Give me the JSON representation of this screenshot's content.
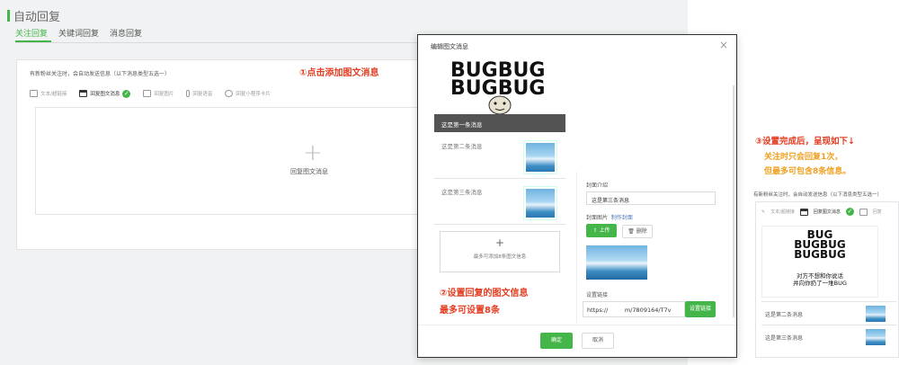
{
  "page": {
    "title": "自动回复",
    "tabs": [
      {
        "label": "关注回复",
        "active": true
      },
      {
        "label": "关键词回复"
      },
      {
        "label": "消息回复"
      }
    ],
    "note": "有新粉丝关注时，会自动发送信息（以下消息类型五选一）",
    "toolbar": [
      {
        "label": "文本/超链接",
        "icon": "pencil-icon"
      },
      {
        "label": "回复图文消息",
        "icon": "news-icon",
        "selected": true
      },
      {
        "label": "回复图片",
        "icon": "image-icon"
      },
      {
        "label": "回复语音",
        "icon": "mic-icon"
      },
      {
        "label": "回复小程序卡片",
        "icon": "miniapp-icon"
      }
    ],
    "add_plus": "+",
    "add_label": "回复图文消息"
  },
  "annotations": {
    "step1": "①点击添加图文消息",
    "step2_line1": "②设置回复的图文信息",
    "step2_line2": "最多可设置8条",
    "step3": "③设置完成后，呈现如下↓",
    "step3_line1": "关注时只会回复1次，",
    "step3_line2": "但最多可包含8条信息。"
  },
  "dialog": {
    "title": "编辑图文消息",
    "close": "×",
    "cover": {
      "meme_line1": "BUGBUG",
      "meme_line2": "BUGBUG",
      "strip": "这是第一条消息"
    },
    "items": [
      {
        "label": "这是第二条消息"
      },
      {
        "label": "这是第三条消息"
      }
    ],
    "add_plus": "+",
    "add_hint": "最多可添加8条图文信息",
    "form": {
      "intro_label": "封面介绍",
      "intro_value": "这是第三条消息",
      "image_label": "封面图片",
      "image_link": "制作封面",
      "upload_btn": "上传",
      "delete_btn": "删除",
      "link_label": "设置链接",
      "link_value": "https://         m/7809164/T7v",
      "link_btn": "设置链接"
    },
    "ok": "确定",
    "cancel": "取消"
  },
  "result": {
    "note": "有新粉丝关注时，会自动发送信息（以下消息类型五选一）",
    "toolbar": [
      {
        "label": "文本/超链接"
      },
      {
        "label": "回复图文消息",
        "selected": true
      },
      {
        "label": "回复"
      }
    ],
    "meme_l1": "BUG",
    "meme_l2": "BUGBUG",
    "meme_l3": "BUGBUG",
    "caption_l1": "对方不想和你说话",
    "caption_l2": "并向你扔了一堆BUG",
    "items": [
      {
        "label": "这是第二条消息"
      },
      {
        "label": "这是第三条消息"
      }
    ]
  },
  "colors": {
    "accent": "#44b549",
    "annotation_red": "#e43c20",
    "annotation_orange": "#f0a020"
  }
}
